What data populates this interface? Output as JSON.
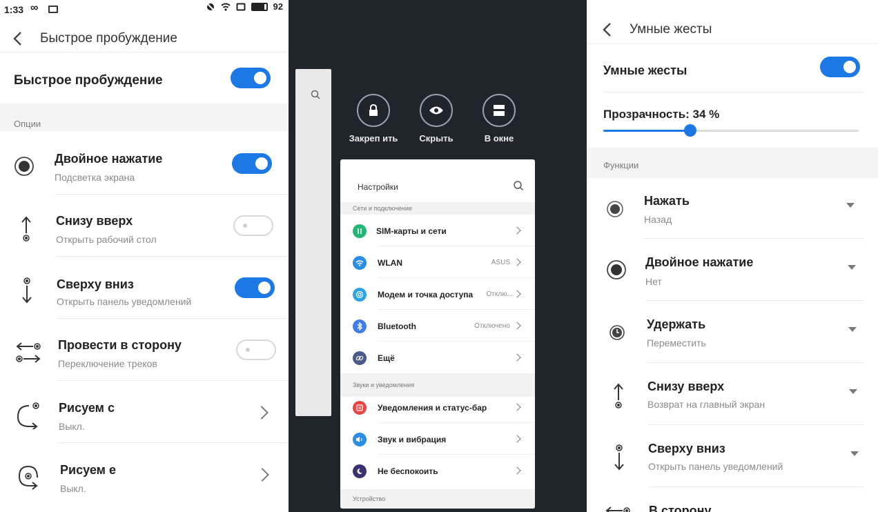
{
  "left": {
    "status": {
      "time": "1:33",
      "battery": "92"
    },
    "header_title": "Быстрое пробуждение",
    "master": {
      "label": "Быстрое пробуждение",
      "enabled": true
    },
    "section_options": "Опции",
    "items": [
      {
        "title": "Двойное нажатие",
        "subtitle": "Подсветка экрана",
        "control": "toggle",
        "enabled": true,
        "icon": "double-tap-icon"
      },
      {
        "title": "Снизу вверх",
        "subtitle": "Открыть рабочий стол",
        "control": "toggle",
        "enabled": false,
        "icon": "swipe-up-icon"
      },
      {
        "title": "Сверху вниз",
        "subtitle": "Открыть панель уведомлений",
        "control": "toggle",
        "enabled": true,
        "icon": "swipe-down-icon"
      },
      {
        "title": "Провести в сторону",
        "subtitle": "Переключение треков",
        "control": "toggle",
        "enabled": false,
        "icon": "swipe-sideways-icon"
      },
      {
        "title": "Рисуем c",
        "subtitle": "Выкл.",
        "control": "chevron",
        "icon": "draw-c-icon"
      },
      {
        "title": "Рисуем e",
        "subtitle": "Выкл.",
        "control": "chevron",
        "icon": "draw-e-icon"
      }
    ]
  },
  "middle": {
    "actions": [
      {
        "label": "Закреп ить",
        "icon": "lock-icon"
      },
      {
        "label": "Скрыть",
        "icon": "eye-icon"
      },
      {
        "label": "В окне",
        "icon": "window-icon"
      }
    ],
    "card": {
      "title": "Настройки",
      "section_network": "Сети и подключение",
      "network_items": [
        {
          "label": "SIM-карты и сети",
          "value": "",
          "color": "#22b573",
          "icon": "sim-icon"
        },
        {
          "label": "WLAN",
          "value": "ASUS",
          "color": "#2a8de8",
          "icon": "wifi-icon"
        },
        {
          "label": "Модем и точка доступа",
          "value": "Отклю...",
          "color": "#2aa3e8",
          "icon": "hotspot-icon"
        },
        {
          "label": "Bluetooth",
          "value": "Отключено",
          "color": "#3f7ee8",
          "icon": "bluetooth-icon"
        },
        {
          "label": "Ещё",
          "value": "",
          "color": "#4a5a8a",
          "icon": "link-icon"
        }
      ],
      "section_sound": "Звуки и уведомления",
      "sound_items": [
        {
          "label": "Уведомления и статус-бар",
          "value": "",
          "color": "#e84545",
          "icon": "notification-icon"
        },
        {
          "label": "Звук и вибрация",
          "value": "",
          "color": "#2a8de8",
          "icon": "volume-icon"
        },
        {
          "label": "Не беспокоить",
          "value": "",
          "color": "#3a3270",
          "icon": "moon-icon"
        }
      ],
      "section_device": "Устройство"
    }
  },
  "right": {
    "header_title": "Умные жесты",
    "master": {
      "label": "Умные жесты",
      "enabled": true
    },
    "transparency": {
      "label": "Прозрачность: 34 %",
      "value": 0.34
    },
    "section_functions": "Функции",
    "items": [
      {
        "title": "Нажать",
        "subtitle": "Назад",
        "icon": "tap-icon"
      },
      {
        "title": "Двойное нажатие",
        "subtitle": "Нет",
        "icon": "double-tap-icon"
      },
      {
        "title": "Удержать",
        "subtitle": "Переместить",
        "icon": "hold-icon"
      },
      {
        "title": "Снизу вверх",
        "subtitle": "Возврат на главный экран",
        "icon": "swipe-up-icon"
      },
      {
        "title": "Сверху вниз",
        "subtitle": "Открыть панель уведомлений",
        "icon": "swipe-down-icon"
      },
      {
        "title": "В сторону",
        "subtitle": "",
        "icon": "swipe-sideways-icon"
      }
    ]
  }
}
